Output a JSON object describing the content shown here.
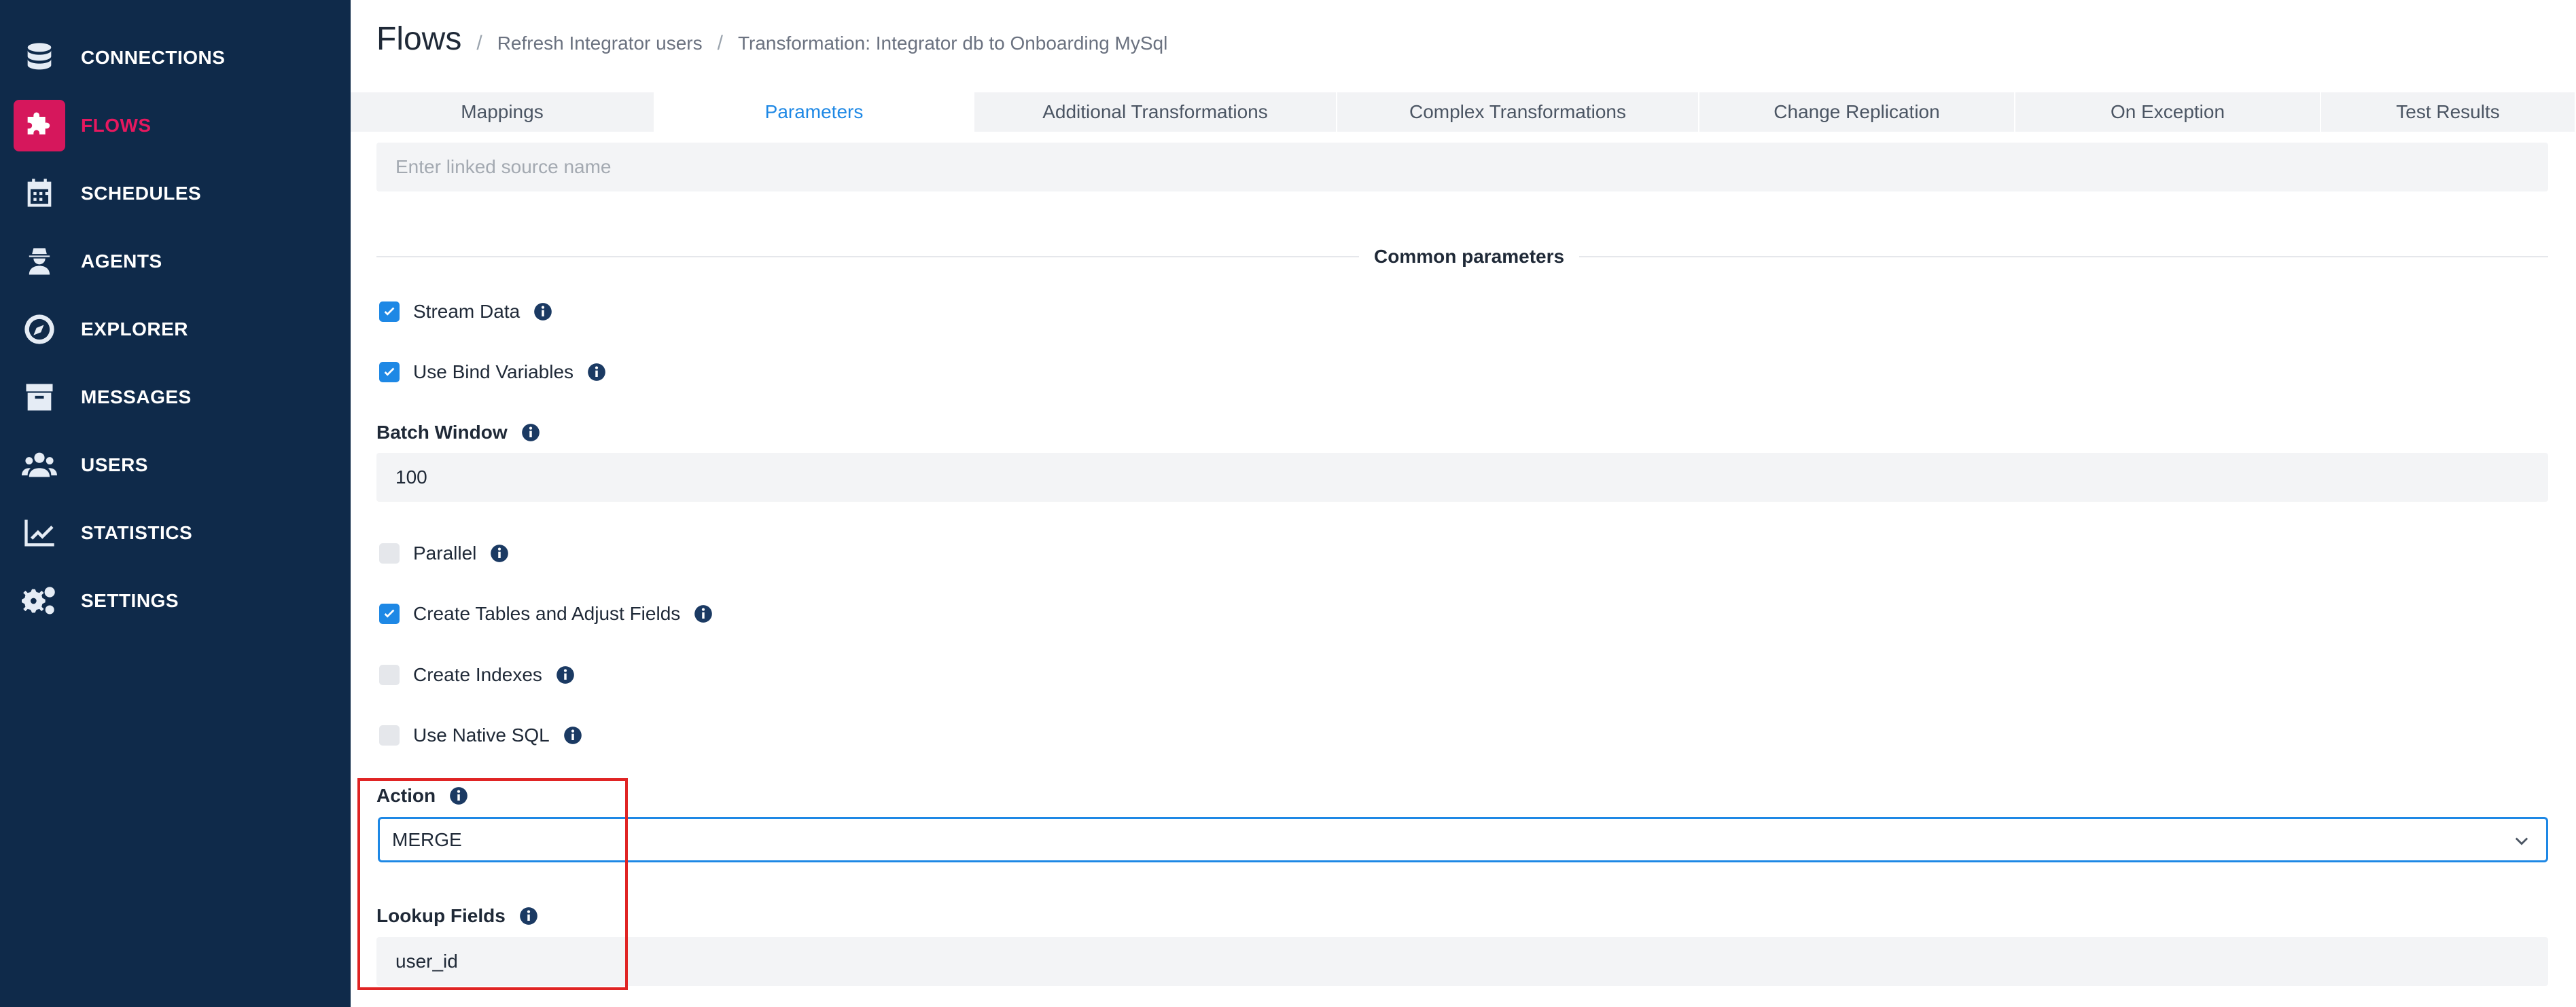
{
  "sidebar": {
    "items": [
      {
        "label": "CONNECTIONS",
        "icon": "database-icon"
      },
      {
        "label": "FLOWS",
        "icon": "puzzle-icon",
        "active": true
      },
      {
        "label": "SCHEDULES",
        "icon": "calendar-icon"
      },
      {
        "label": "AGENTS",
        "icon": "agent-icon"
      },
      {
        "label": "EXPLORER",
        "icon": "compass-icon"
      },
      {
        "label": "MESSAGES",
        "icon": "archive-icon"
      },
      {
        "label": "USERS",
        "icon": "users-icon"
      },
      {
        "label": "STATISTICS",
        "icon": "chart-line-icon"
      },
      {
        "label": "SETTINGS",
        "icon": "gears-icon"
      }
    ],
    "background": "#0f2a4a",
    "active_color": "#d6175c"
  },
  "breadcrumb": {
    "title": "Flows",
    "items": [
      "Refresh Integrator users",
      "Transformation: Integrator db to Onboarding MySql"
    ],
    "separator": "/"
  },
  "tabs": [
    {
      "label": "Mappings"
    },
    {
      "label": "Parameters",
      "active": true
    },
    {
      "label": "Additional Transformations"
    },
    {
      "label": "Complex Transformations"
    },
    {
      "label": "Change Replication"
    },
    {
      "label": "On Exception"
    },
    {
      "label": "Test Results"
    }
  ],
  "linked_source": {
    "placeholder": "Enter linked source name",
    "value": ""
  },
  "common_parameters": {
    "heading": "Common parameters",
    "stream_data": {
      "label": "Stream Data",
      "checked": true
    },
    "use_bind_variables": {
      "label": "Use Bind Variables",
      "checked": true
    },
    "batch_window": {
      "label": "Batch Window",
      "value": "100"
    },
    "parallel": {
      "label": "Parallel",
      "checked": false
    },
    "create_tables": {
      "label": "Create Tables and Adjust Fields",
      "checked": true
    },
    "create_indexes": {
      "label": "Create Indexes",
      "checked": false
    },
    "use_native_sql": {
      "label": "Use Native SQL",
      "checked": false
    },
    "action": {
      "label": "Action",
      "value": "MERGE"
    },
    "lookup_fields": {
      "label": "Lookup Fields",
      "value": "user_id"
    }
  },
  "colors": {
    "accent": "#1e88e5",
    "highlight": "#e02424",
    "info_icon": "#1b3a63"
  }
}
